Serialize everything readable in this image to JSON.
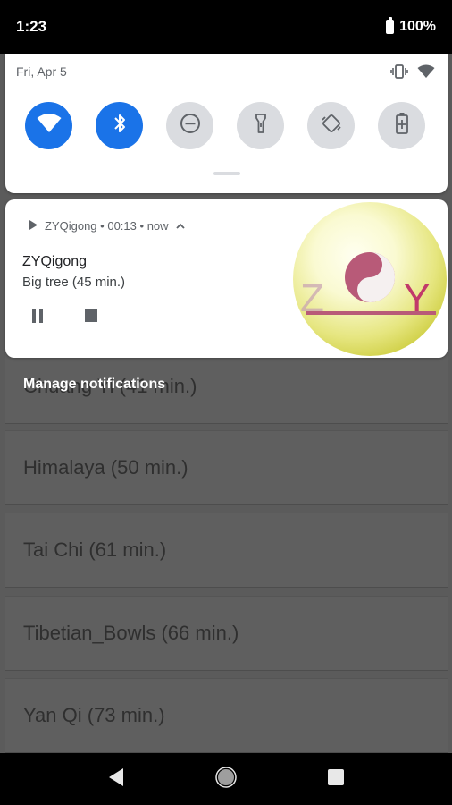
{
  "status_bar": {
    "time": "1:23",
    "battery": "100%"
  },
  "quick_settings": {
    "date": "Fri, Apr 5",
    "tiles": [
      {
        "name": "wifi",
        "active": true
      },
      {
        "name": "bluetooth",
        "active": true
      },
      {
        "name": "do-not-disturb",
        "active": false
      },
      {
        "name": "flashlight",
        "active": false
      },
      {
        "name": "auto-rotate",
        "active": false
      },
      {
        "name": "battery-saver",
        "active": false
      }
    ]
  },
  "notification": {
    "app_name": "ZYQigong",
    "elapsed": "00:13",
    "when": "now",
    "title": "ZYQigong",
    "text": "Big tree (45 min.)",
    "logo_letters": [
      "Z",
      "Y"
    ]
  },
  "manage_notifications": "Manage notifications",
  "app_list": {
    "items": [
      "Chuang Yi (41 min.)",
      "Himalaya (50 min.)",
      "Tai Chi (61 min.)",
      "Tibetian_Bowls (66 min.)",
      "Yan Qi (73 min.)"
    ]
  }
}
